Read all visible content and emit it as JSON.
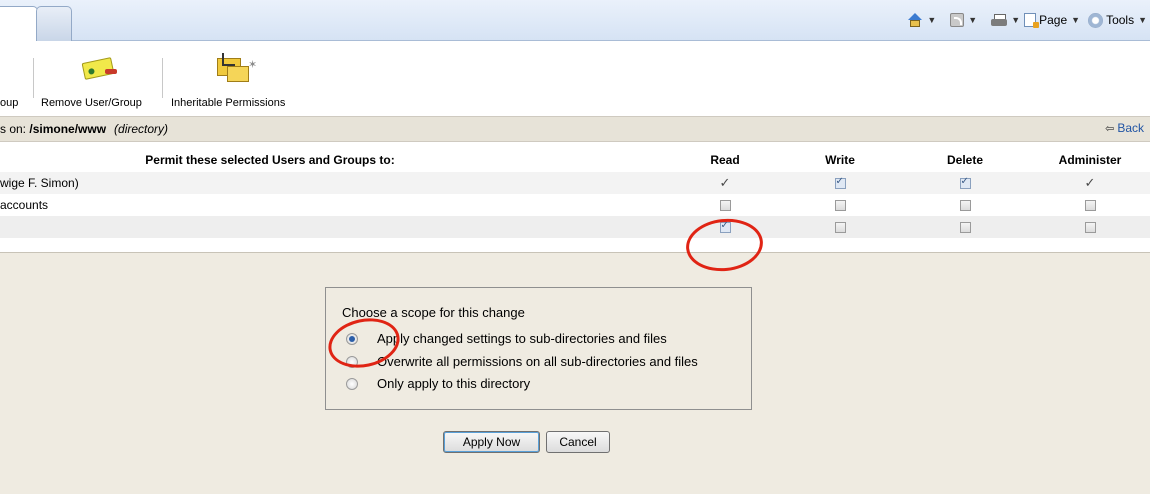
{
  "browser": {
    "commands": {
      "page": "Page",
      "tools": "Tools"
    }
  },
  "toolbar": {
    "partial_label": "oup",
    "remove_label": "Remove User/Group",
    "inherit_label": "Inheritable Permissions"
  },
  "pathbar": {
    "prefix": "s on: ",
    "path": "/simone/www",
    "type": "(directory)",
    "back": "Back"
  },
  "table": {
    "headers": {
      "permit": "Permit these selected Users and Groups to:",
      "read": "Read",
      "write": "Write",
      "delete": "Delete",
      "administer": "Administer"
    },
    "rows": [
      {
        "name": "wige F. Simon)",
        "read": "tick",
        "write": "checked",
        "delete": "checked",
        "administer": "tick"
      },
      {
        "name": " accounts",
        "read": "unchecked",
        "write": "unchecked",
        "delete": "unchecked",
        "administer": "unchecked"
      },
      {
        "name": "",
        "read": "checked",
        "write": "unchecked",
        "delete": "unchecked",
        "administer": "unchecked"
      }
    ]
  },
  "scope": {
    "title": "Choose a scope for this change",
    "options": [
      {
        "label": "Apply changed settings to sub-directories and files",
        "selected": true
      },
      {
        "label": "Overwrite all permissions on all sub-directories and files",
        "selected": false
      },
      {
        "label": "Only apply to this directory",
        "selected": false
      }
    ]
  },
  "buttons": {
    "apply": "Apply Now",
    "cancel": "Cancel"
  },
  "colors": {
    "annotation": "#e02414",
    "panel_bg": "#efebe1",
    "link": "#2255a4"
  }
}
